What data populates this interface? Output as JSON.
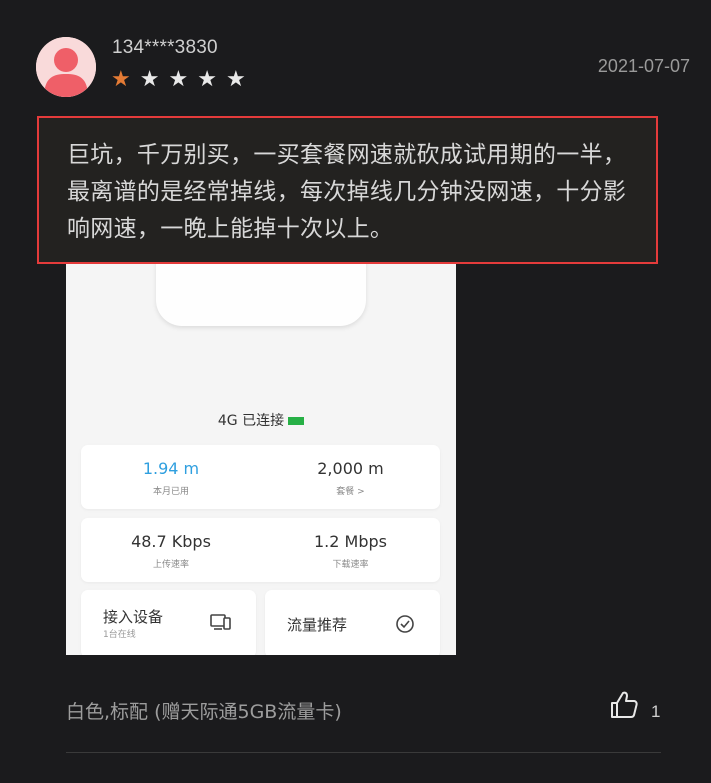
{
  "review": {
    "username": "134****3830",
    "date": "2021-07-07",
    "rating": 1,
    "max_rating": 5,
    "text": "巨坑，千万别买，一买套餐网速就砍成试用期的一半，最离谱的是经常掉线，每次掉线几分钟没网速，十分影响网速，一晚上能掉十次以上。",
    "spec": "白色,标配 (赠天际通5GB流量卡)",
    "likes": "1"
  },
  "product_screen": {
    "status": "4G 已连接",
    "stat1_value": "1.94 m",
    "stat1_label": "本月已用",
    "stat2_value": "2,000 m",
    "stat2_label": "套餐 >",
    "stat3_value": "48.7 Kbps",
    "stat3_label": "上传速率",
    "stat4_value": "1.2 Mbps",
    "stat4_label": "下载速率",
    "connected_label": "接入设备",
    "connected_sub": "1台在线",
    "package_label": "流量推荐"
  },
  "colors": {
    "background": "#1b1b1d",
    "star_filled": "#e47b35",
    "star_empty": "#e9e9e9",
    "highlight_border": "#e43b3b"
  },
  "icons": {
    "avatar": "default-user-avatar",
    "like": "thumbs-up-icon",
    "connected": "devices-icon",
    "package": "refresh-icon"
  }
}
